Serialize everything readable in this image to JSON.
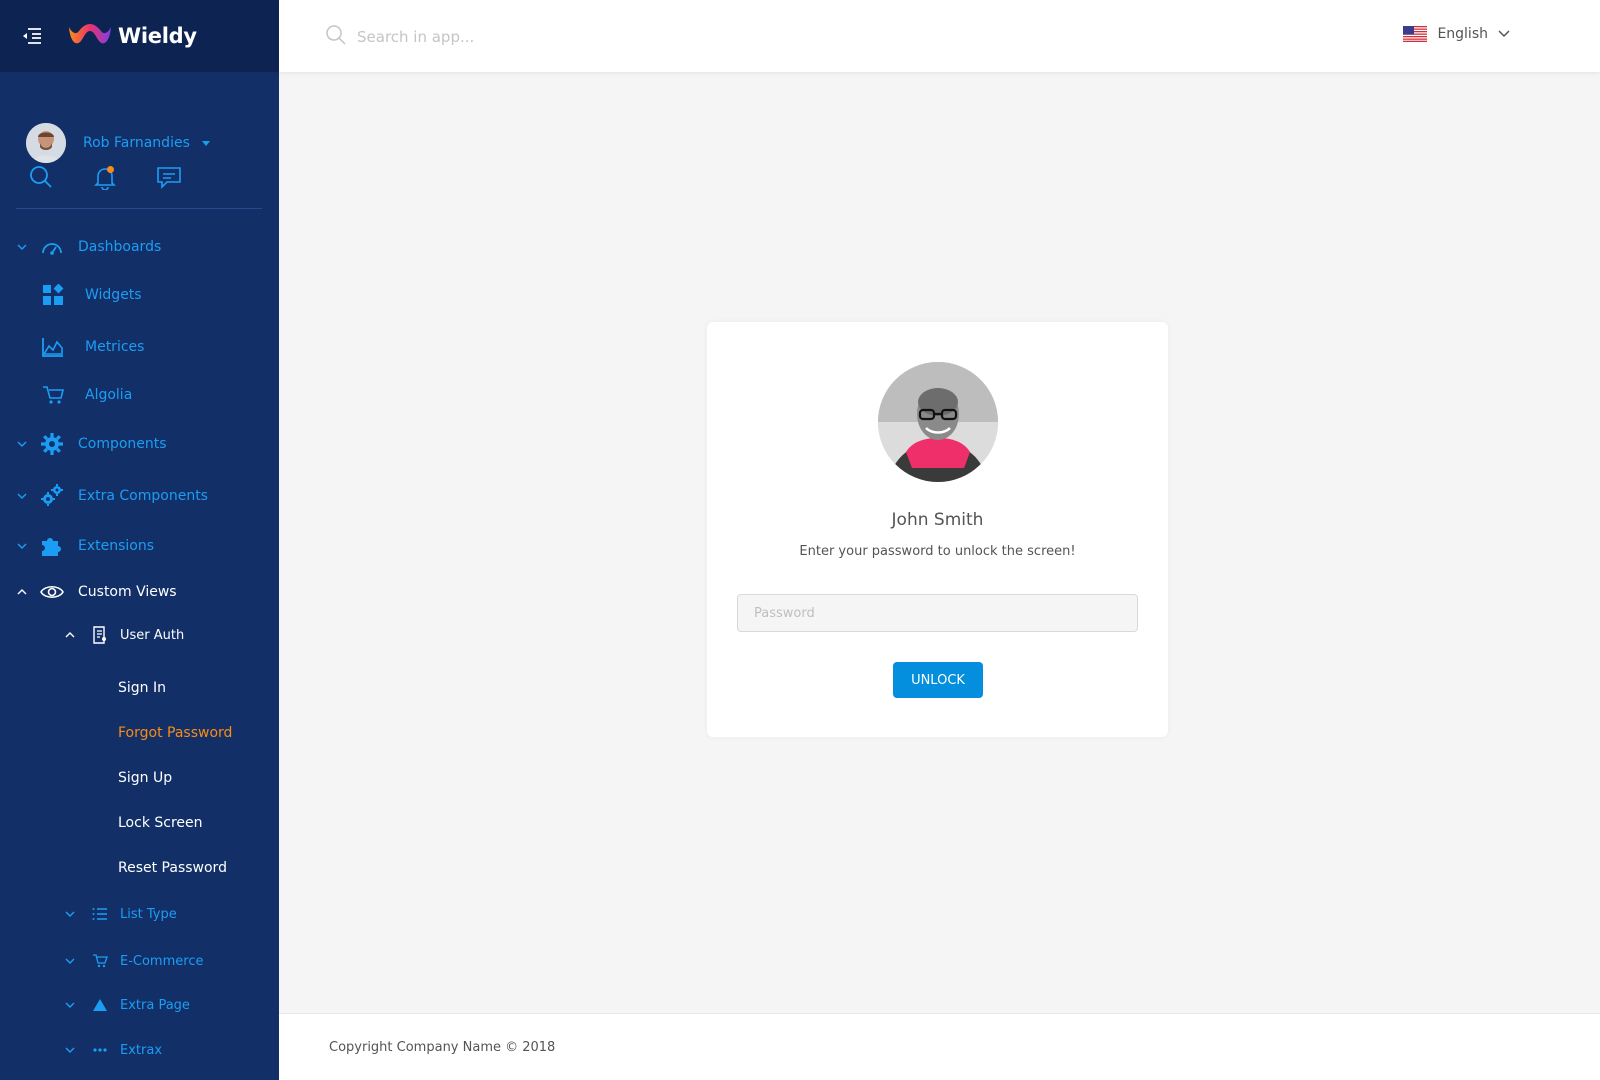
{
  "brand": {
    "name": "Wieldy"
  },
  "profile": {
    "name": "Rob Farnandies"
  },
  "search": {
    "placeholder": "Search in app..."
  },
  "language": {
    "label": "English"
  },
  "nav": {
    "dashboards": "Dashboards",
    "widgets": "Widgets",
    "metrices": "Metrices",
    "algolia": "Algolia",
    "components": "Components",
    "extra_components": "Extra Components",
    "extensions": "Extensions",
    "custom_views": "Custom Views",
    "user_auth": "User Auth",
    "sign_in": "Sign In",
    "forgot_password": "Forgot Password",
    "sign_up": "Sign Up",
    "lock_screen": "Lock Screen",
    "reset_password": "Reset Password",
    "list_type": "List Type",
    "ecommerce": "E-Commerce",
    "extra_page": "Extra Page",
    "extrax": "Extrax"
  },
  "lock": {
    "user_name": "John Smith",
    "hint": "Enter your password to unlock the screen!",
    "password_placeholder": "Password",
    "unlock_label": "UNLOCK"
  },
  "footer": {
    "text": "Copyright Company Name © 2018"
  },
  "colors": {
    "sidebar_bg": "#123067",
    "sidebar_header_bg": "#0d2452",
    "accent_blue": "#1c9df4",
    "active_orange": "#fa8c16",
    "button_blue": "#038fde"
  }
}
